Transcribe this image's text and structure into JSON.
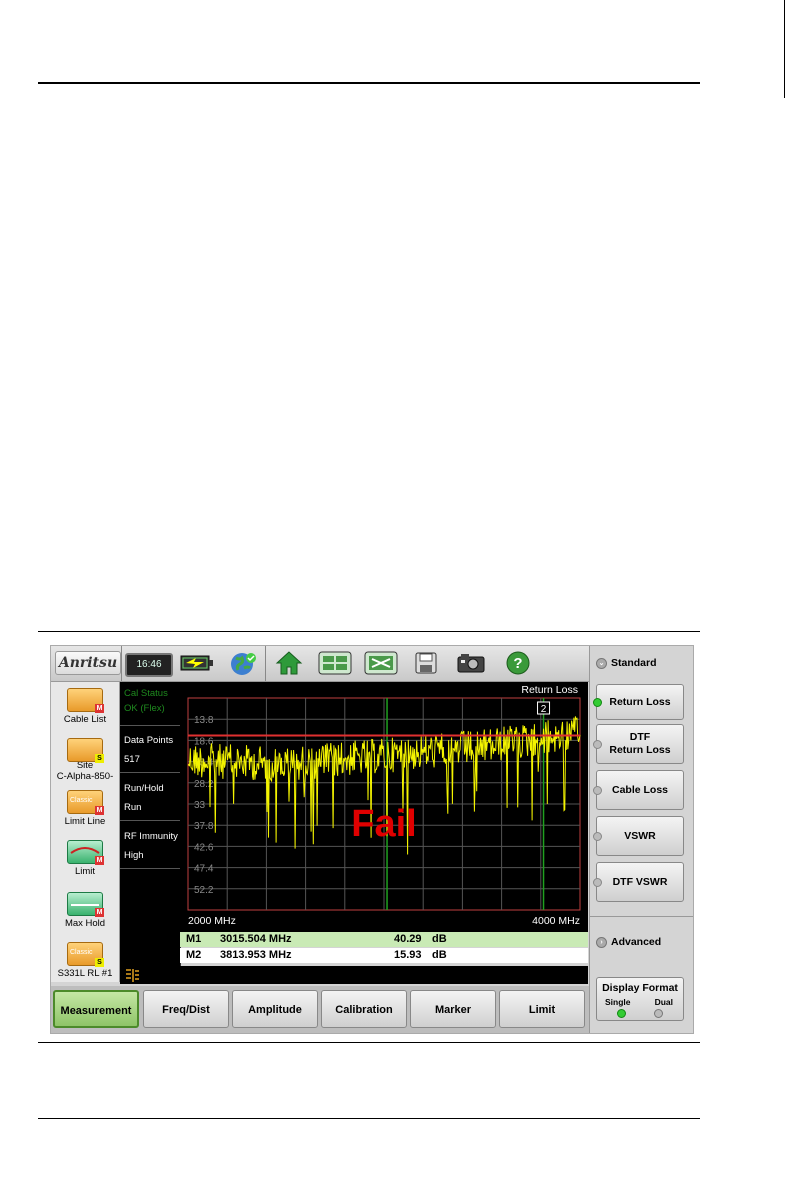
{
  "app": {
    "logo": "Anritsu",
    "clock": "16:46"
  },
  "toolbar": {
    "icons": [
      "battery-icon",
      "globe-icon",
      "home-icon",
      "grid-view-icon",
      "fullscreen-icon",
      "save-icon",
      "camera-icon",
      "help-icon"
    ],
    "help_glyph": "?"
  },
  "left_panel": {
    "items": [
      {
        "label": "Cable List",
        "badge": "M"
      },
      {
        "label": "Site",
        "sublabel": "C-Alpha-850-",
        "badge": "S"
      },
      {
        "label": "Limit Line",
        "badge": "M",
        "tag": "Classic"
      },
      {
        "label": "Limit",
        "badge": "M"
      },
      {
        "label": "Max Hold",
        "badge": "M"
      },
      {
        "label": "S331L RL #1",
        "badge": "S",
        "tag": "Classic"
      }
    ]
  },
  "status": {
    "cal_status_label": "Cal Status",
    "cal_status_value": "OK (Flex)",
    "data_points_label": "Data Points",
    "data_points_value": "517",
    "run_hold_label": "Run/Hold",
    "run_hold_value": "Run",
    "rf_immunity_label": "RF Immunity",
    "rf_immunity_value": "High"
  },
  "plot": {
    "title": "Return Loss",
    "fail_text": "Fail",
    "x_start_label": "2000 MHz",
    "x_end_label": "4000 MHz",
    "y_ticks": [
      "13.8",
      "18.6",
      "23.4",
      "28.2",
      "33",
      "37.8",
      "42.6",
      "47.4",
      "52.2"
    ],
    "marker_flag": "2",
    "colors": {
      "trace": "#f4f400",
      "limit": "#e03030",
      "grid": "#555555",
      "marker_line": "#20a020",
      "fail": "#e00000"
    }
  },
  "chart_data": {
    "type": "line",
    "title": "Return Loss",
    "xlabel": "",
    "ylabel": "",
    "xlim": [
      2000,
      4000
    ],
    "ylim": [
      57,
      9
    ],
    "x_unit": "MHz",
    "y_unit": "dB",
    "limit_line": 17.5,
    "markers": [
      {
        "name": "M1",
        "x": 3015.504,
        "y": 40.29
      },
      {
        "name": "M2",
        "x": 3813.953,
        "y": 15.93
      }
    ],
    "series": [
      {
        "values_trend": [
          [
            2000,
            23
          ],
          [
            2500,
            24
          ],
          [
            3000,
            22
          ],
          [
            3500,
            20
          ],
          [
            4000,
            17
          ]
        ]
      }
    ]
  },
  "markers_table": [
    {
      "id": "M1",
      "freq": "3015.504 MHz",
      "value": "40.29",
      "unit": "dB"
    },
    {
      "id": "M2",
      "freq": "3813.953 MHz",
      "value": "15.93",
      "unit": "dB"
    }
  ],
  "right_panel": {
    "group_standard": "Standard",
    "buttons": [
      {
        "label": "Return Loss",
        "active": true
      },
      {
        "label": "DTF",
        "label2": "Return Loss",
        "active": false
      },
      {
        "label": "Cable Loss",
        "active": false
      },
      {
        "label": "VSWR",
        "active": false
      },
      {
        "label": "DTF VSWR",
        "active": false
      }
    ],
    "group_advanced": "Advanced",
    "display_format": {
      "label": "Display Format",
      "single": "Single",
      "dual": "Dual"
    }
  },
  "tabs": [
    {
      "label": "Measurement",
      "active": true
    },
    {
      "label": "Freq/Dist"
    },
    {
      "label": "Amplitude"
    },
    {
      "label": "Calibration"
    },
    {
      "label": "Marker"
    },
    {
      "label": "Limit"
    }
  ]
}
